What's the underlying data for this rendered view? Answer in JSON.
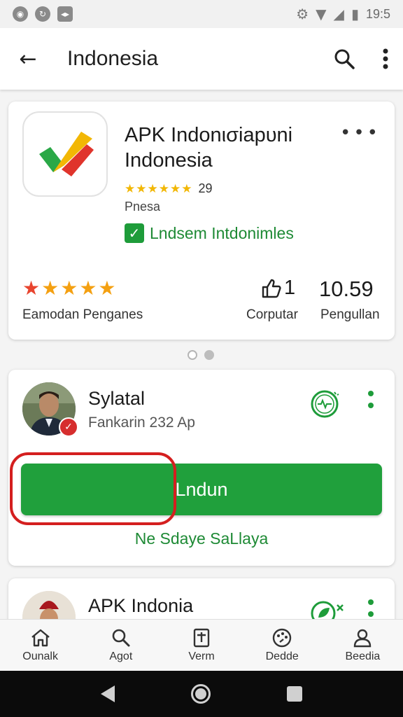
{
  "status_bar": {
    "time": "19:5",
    "left_icons": [
      "app-notif-icon",
      "sync-icon",
      "media-icon"
    ],
    "right_icons": [
      "settings-icon",
      "wifi-icon",
      "signal-icon",
      "battery-icon"
    ]
  },
  "app_bar": {
    "title": "Indonesia",
    "back_icon": "arrow-left-icon",
    "search_icon": "search-icon",
    "more_icon": "more-vertical-icon"
  },
  "app_card": {
    "name": "APK Indonισiapυni Indonesia",
    "rating_stars": "★★★★★★",
    "rating_count": "29",
    "publisher": "Pnesa",
    "verified_label": "Lndsem Intdonimles",
    "stats": {
      "stars_rating": 4.5,
      "stars_label": "Eamodan Penganes",
      "stat2_value": "1",
      "stat2_label": "Corputar",
      "stat3_value": "10.59",
      "stat3_label": "Pengullan"
    }
  },
  "pager": {
    "pages": 2,
    "active": 2
  },
  "user_card": {
    "name": "Sylatal",
    "subtitle": "Fankarin 232 Ap",
    "download_label": "Lndun",
    "secondary_link": "Ne Sdaye SaLlaya"
  },
  "next_card": {
    "name": "APK Indonia"
  },
  "bottom_nav": {
    "items": [
      {
        "label": "Ounalk",
        "icon": "home-icon"
      },
      {
        "label": "Agot",
        "icon": "search-icon"
      },
      {
        "label": "Verm",
        "icon": "document-icon"
      },
      {
        "label": "Dedde",
        "icon": "palette-icon"
      },
      {
        "label": "Beedia",
        "icon": "person-icon"
      }
    ]
  },
  "colors": {
    "accent_green": "#20a03c",
    "highlight_red": "#d41f1f",
    "star_yellow": "#f2b705"
  }
}
